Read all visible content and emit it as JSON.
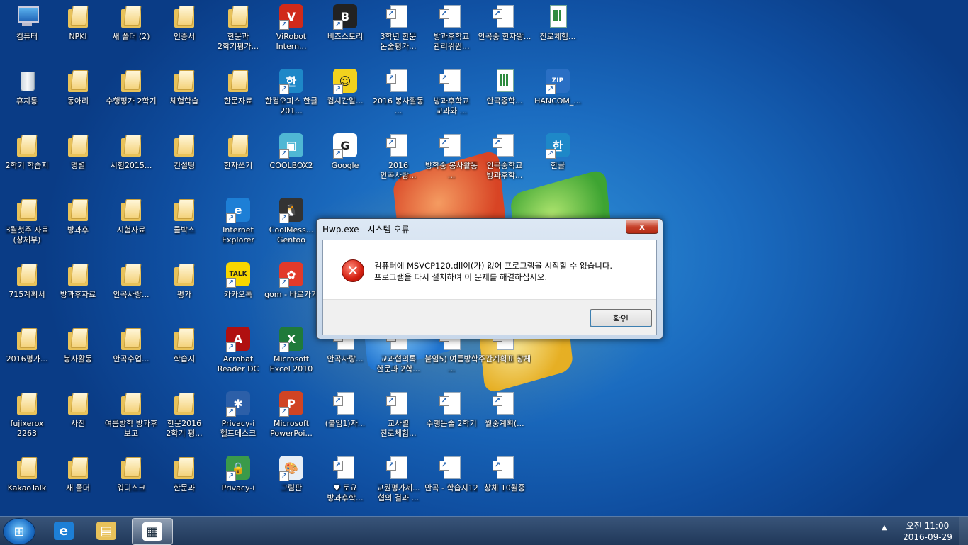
{
  "desktop_icons": [
    {
      "label": "컴퓨터",
      "icon": "computer-icon",
      "kind": "computer"
    },
    {
      "label": "NPKI",
      "icon": "folder-icon",
      "kind": "folder"
    },
    {
      "label": "새 폴더 (2)",
      "icon": "folder-icon",
      "kind": "folder"
    },
    {
      "label": "인증서",
      "icon": "folder-icon",
      "kind": "folder"
    },
    {
      "label": "한문과 2학기평가...",
      "icon": "folder-icon",
      "kind": "folder"
    },
    {
      "label": "ViRobot Intern...",
      "icon": "virobot-icon",
      "kind": "app",
      "color": "#d02a1a",
      "glyph": "V"
    },
    {
      "label": "비즈스토리",
      "icon": "bizstory-icon",
      "kind": "app",
      "color": "#222222",
      "glyph": "B"
    },
    {
      "label": "3학년 한문 논술평가...",
      "icon": "hwp-document-icon",
      "kind": "doc"
    },
    {
      "label": "방과후학교 관리위원...",
      "icon": "hwp-document-icon",
      "kind": "doc"
    },
    {
      "label": "안곡중 한자왕...",
      "icon": "hwp-document-icon",
      "kind": "doc"
    },
    {
      "label": "진로체험...",
      "icon": "spreadsheet-icon",
      "kind": "xls"
    },
    {
      "label": "휴지통",
      "icon": "recycle-bin-icon",
      "kind": "bin"
    },
    {
      "label": "동아리",
      "icon": "folder-icon",
      "kind": "folder"
    },
    {
      "label": "수행평가 2학기",
      "icon": "folder-icon",
      "kind": "folder"
    },
    {
      "label": "체험학습",
      "icon": "folder-icon",
      "kind": "folder"
    },
    {
      "label": "한문자료",
      "icon": "folder-icon",
      "kind": "folder"
    },
    {
      "label": "한컴오피스 한글 201...",
      "icon": "hancom-office-icon",
      "kind": "app",
      "color": "#1e88c8",
      "glyph": "한"
    },
    {
      "label": "컴시간알...",
      "icon": "smiley-icon",
      "kind": "app",
      "color": "#f2d21e",
      "glyph": "☺"
    },
    {
      "label": "2016 봉사활동 ...",
      "icon": "hwp-document-icon",
      "kind": "doc"
    },
    {
      "label": "방과후학교 교과와 ...",
      "icon": "hwp-document-icon",
      "kind": "doc"
    },
    {
      "label": "안곡중학...",
      "icon": "spreadsheet-icon",
      "kind": "xls"
    },
    {
      "label": "HANCOM_...",
      "icon": "zip-archive-icon",
      "kind": "app",
      "color": "#2a6fc4",
      "glyph": "ZIP"
    },
    {
      "label": "2학기 학습지",
      "icon": "folder-icon",
      "kind": "folder"
    },
    {
      "label": "명렬",
      "icon": "folder-icon",
      "kind": "folder"
    },
    {
      "label": "시험2015...",
      "icon": "folder-icon",
      "kind": "folder"
    },
    {
      "label": "컨설팅",
      "icon": "folder-icon",
      "kind": "folder"
    },
    {
      "label": "한자쓰기",
      "icon": "folder-icon",
      "kind": "folder"
    },
    {
      "label": "COOLBOX2",
      "icon": "coolbox-icon",
      "kind": "app",
      "color": "#4fb7d4",
      "glyph": "▣"
    },
    {
      "label": "Google",
      "icon": "google-icon",
      "kind": "app",
      "color": "#ffffff",
      "glyph": "G"
    },
    {
      "label": "2016 안곡사랑...",
      "icon": "hwp-document-icon",
      "kind": "doc"
    },
    {
      "label": "방학중 봉사활동 ...",
      "icon": "hwp-document-icon",
      "kind": "doc"
    },
    {
      "label": "안곡중학교 방과후학...",
      "icon": "hwp-document-icon",
      "kind": "doc"
    },
    {
      "label": "한글",
      "icon": "hangul-app-icon",
      "kind": "app",
      "color": "#1e88c8",
      "glyph": "한"
    },
    {
      "label": "3월첫주 자료(창체부)",
      "icon": "folder-icon",
      "kind": "folder"
    },
    {
      "label": "방과후",
      "icon": "folder-icon",
      "kind": "folder"
    },
    {
      "label": "시험자료",
      "icon": "folder-icon",
      "kind": "folder"
    },
    {
      "label": "쿨박스",
      "icon": "folder-icon",
      "kind": "folder"
    },
    {
      "label": "Internet Explorer",
      "icon": "internet-explorer-icon",
      "kind": "app",
      "color": "#1d7fd6",
      "glyph": "e"
    },
    {
      "label": "CoolMess... Gentoo",
      "icon": "penguin-icon",
      "kind": "app",
      "color": "#333333",
      "glyph": "🐧"
    },
    {
      "label": "715계획서",
      "icon": "folder-icon",
      "kind": "folder"
    },
    {
      "label": "방과후자료",
      "icon": "folder-icon",
      "kind": "folder"
    },
    {
      "label": "안곡사랑...",
      "icon": "folder-icon",
      "kind": "folder"
    },
    {
      "label": "평가",
      "icon": "folder-icon",
      "kind": "folder"
    },
    {
      "label": "카카오톡",
      "icon": "kakaotalk-icon",
      "kind": "app",
      "color": "#f7d600",
      "glyph": "TALK"
    },
    {
      "label": "gom - 바로가기",
      "icon": "gom-player-icon",
      "kind": "app",
      "color": "#e23a2a",
      "glyph": "✿"
    },
    {
      "label": "2016평가...",
      "icon": "folder-icon",
      "kind": "folder"
    },
    {
      "label": "봉사활동",
      "icon": "folder-icon",
      "kind": "folder"
    },
    {
      "label": "안곡수업...",
      "icon": "folder-icon",
      "kind": "folder"
    },
    {
      "label": "학습지",
      "icon": "folder-icon",
      "kind": "folder"
    },
    {
      "label": "Acrobat Reader DC",
      "icon": "acrobat-icon",
      "kind": "app",
      "color": "#b01010",
      "glyph": "A"
    },
    {
      "label": "Microsoft Excel 2010",
      "icon": "excel-icon",
      "kind": "app",
      "color": "#1f7a3a",
      "glyph": "X"
    },
    {
      "label": "안곡사랑...",
      "icon": "pdf-document-icon",
      "kind": "doc"
    },
    {
      "label": "교과협의록 한문과 2학...",
      "icon": "hwp-document-icon",
      "kind": "doc"
    },
    {
      "label": "붙임5) 여름방학 ...",
      "icon": "hwp-document-icon",
      "kind": "doc"
    },
    {
      "label": "주간계획표 창체",
      "icon": "hwp-document-icon",
      "kind": "doc"
    },
    {
      "label": "fujixerox 2263",
      "icon": "folder-icon",
      "kind": "folder"
    },
    {
      "label": "사진",
      "icon": "folder-icon",
      "kind": "folder"
    },
    {
      "label": "여름방학 방과후 보고",
      "icon": "folder-icon",
      "kind": "folder"
    },
    {
      "label": "한문2016 2학기 평...",
      "icon": "folder-icon",
      "kind": "folder"
    },
    {
      "label": "Privacy-i 헬프데스크",
      "icon": "privacy-i-icon",
      "kind": "app",
      "color": "#2c5fa8",
      "glyph": "✱"
    },
    {
      "label": "Microsoft PowerPoi...",
      "icon": "powerpoint-icon",
      "kind": "app",
      "color": "#d04423",
      "glyph": "P"
    },
    {
      "label": "(붙임1)자...",
      "icon": "hwp-document-icon",
      "kind": "doc"
    },
    {
      "label": "교사별 진로체험...",
      "icon": "hwp-document-icon",
      "kind": "doc"
    },
    {
      "label": "수행논술 2학기",
      "icon": "hwp-document-icon",
      "kind": "doc"
    },
    {
      "label": "월중계획(...",
      "icon": "hwp-document-icon",
      "kind": "doc"
    },
    {
      "label": "KakaoTalk",
      "icon": "folder-icon",
      "kind": "folder"
    },
    {
      "label": "새 폴더",
      "icon": "folder-icon",
      "kind": "folder"
    },
    {
      "label": "워디스크",
      "icon": "folder-icon",
      "kind": "folder"
    },
    {
      "label": "한문과",
      "icon": "folder-icon",
      "kind": "folder"
    },
    {
      "label": "Privacy-i",
      "icon": "privacy-i-lock-icon",
      "kind": "app",
      "color": "#3a9a4a",
      "glyph": "🔒"
    },
    {
      "label": "그림판",
      "icon": "paint-icon",
      "kind": "app",
      "color": "#e7eef6",
      "glyph": "🎨"
    },
    {
      "label": "♥ 토요 방과후학...",
      "icon": "hwp-document-icon",
      "kind": "doc"
    },
    {
      "label": "교원평가제... 협의 결과 ...",
      "icon": "hwp-document-icon",
      "kind": "doc"
    },
    {
      "label": "안곡 - 학습지12",
      "icon": "hwp-document-icon",
      "kind": "doc"
    },
    {
      "label": "창체 10월중",
      "icon": "hwp-document-icon",
      "kind": "doc"
    }
  ],
  "dialog": {
    "title": "Hwp.exe - 시스템 오류",
    "close_label": "x",
    "error_icon": "error-x-icon",
    "message_line1": "컴퓨터에 MSVCP120.dll이(가) 없어 프로그램을 시작할 수 없습니다.",
    "message_line2": "프로그램을 다시 설치하여 이 문제를 해결하십시오.",
    "ok_label": "확인"
  },
  "taskbar": {
    "start_icon": "windows-start-icon",
    "pinned": [
      {
        "name": "internet-explorer-icon",
        "glyph": "e",
        "color": "#1d7fd6"
      },
      {
        "name": "file-explorer-icon",
        "glyph": "▤",
        "color": "#e8c25a"
      },
      {
        "name": "hwp-window-icon",
        "glyph": "▦",
        "color": "#ffffff"
      }
    ],
    "clock_time": "오전 11:00",
    "clock_date": "2016-09-29",
    "tray_arrow": "▲"
  }
}
